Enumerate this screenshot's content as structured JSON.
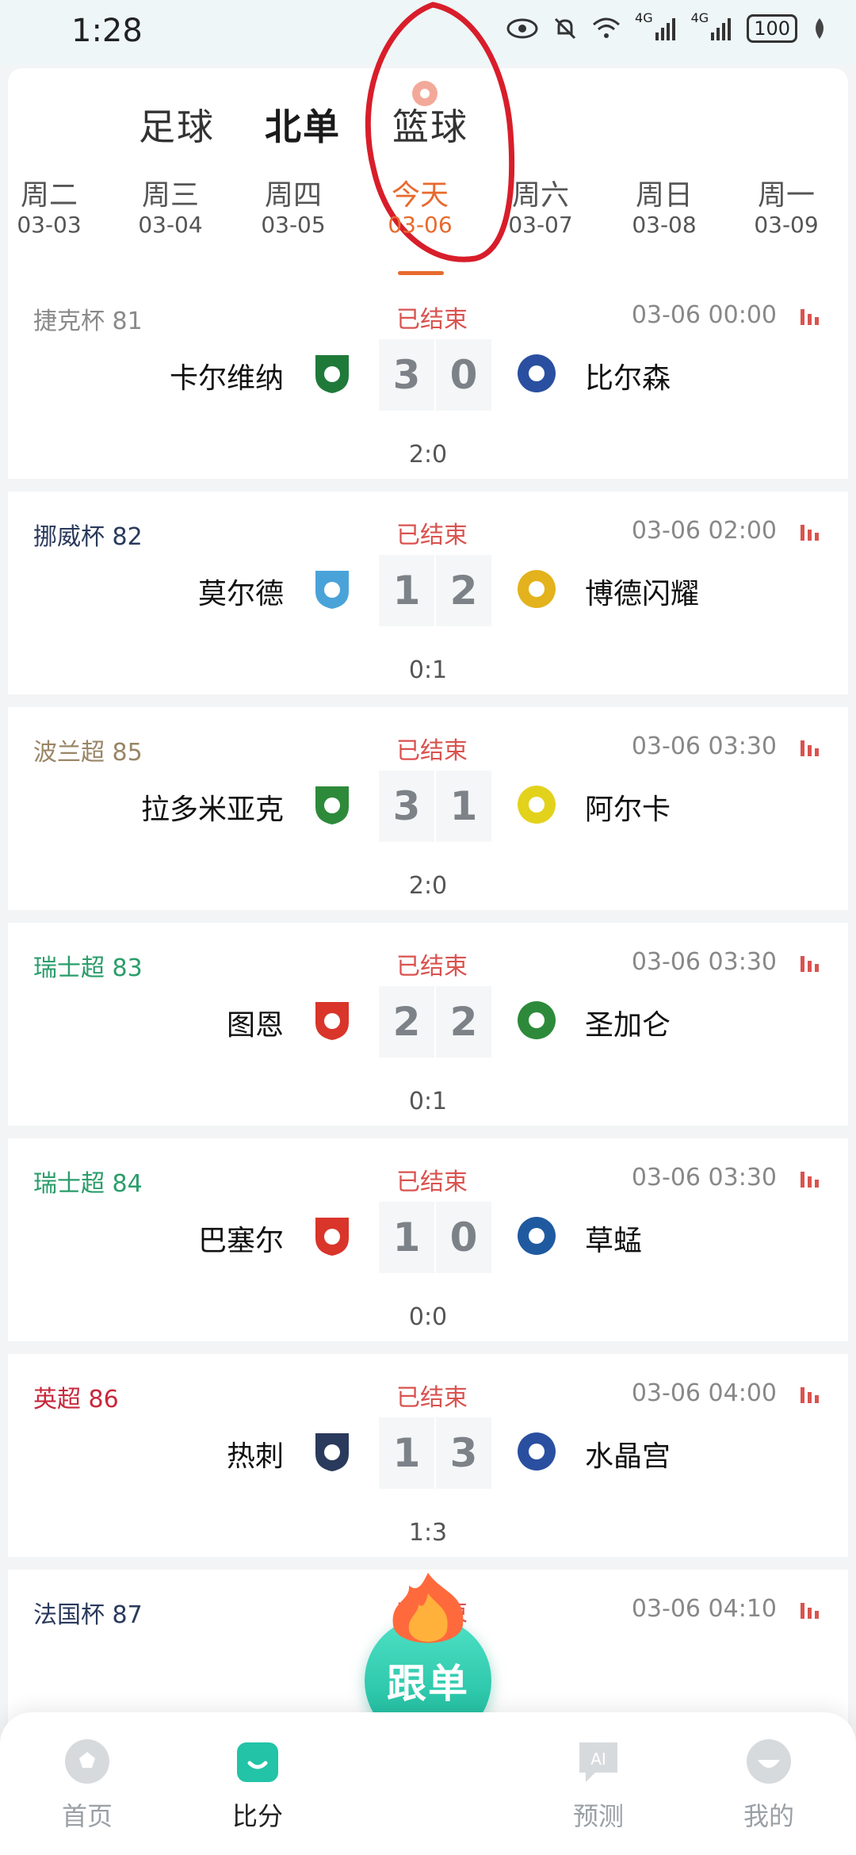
{
  "status_bar": {
    "time": "1:28",
    "battery": "100",
    "network_labels": [
      "4G",
      "4G"
    ]
  },
  "top_tabs": [
    {
      "label": "足球",
      "active": false
    },
    {
      "label": "北单",
      "active": true
    },
    {
      "label": "篮球",
      "active": false
    }
  ],
  "dates": [
    {
      "weekday": "周二",
      "date": "03-03",
      "active": false
    },
    {
      "weekday": "周三",
      "date": "03-04",
      "active": false
    },
    {
      "weekday": "周四",
      "date": "03-05",
      "active": false
    },
    {
      "weekday": "今天",
      "date": "03-06",
      "active": true
    },
    {
      "weekday": "周六",
      "date": "03-07",
      "active": false
    },
    {
      "weekday": "周日",
      "date": "03-08",
      "active": false
    },
    {
      "weekday": "周一",
      "date": "03-09",
      "active": false
    }
  ],
  "matches": [
    {
      "league": "捷克杯 81",
      "league_color": "#8a8a8a",
      "status": "已结束",
      "time": "03-06 00:00",
      "home": "卡尔维纳",
      "away": "比尔森",
      "home_score": "3",
      "away_score": "0",
      "half_time": "2:0"
    },
    {
      "league": "挪威杯 82",
      "league_color": "#2a3a5c",
      "status": "已结束",
      "time": "03-06 02:00",
      "home": "莫尔德",
      "away": "博德闪耀",
      "home_score": "1",
      "away_score": "2",
      "half_time": "0:1"
    },
    {
      "league": "波兰超 85",
      "league_color": "#9a8566",
      "status": "已结束",
      "time": "03-06 03:30",
      "home": "拉多米亚克",
      "away": "阿尔卡",
      "home_score": "3",
      "away_score": "1",
      "half_time": "2:0"
    },
    {
      "league": "瑞士超 83",
      "league_color": "#2a9d6a",
      "status": "已结束",
      "time": "03-06 03:30",
      "home": "图恩",
      "away": "圣加仑",
      "home_score": "2",
      "away_score": "2",
      "half_time": "0:1"
    },
    {
      "league": "瑞士超 84",
      "league_color": "#2a9d6a",
      "status": "已结束",
      "time": "03-06 03:30",
      "home": "巴塞尔",
      "away": "草蜢",
      "home_score": "1",
      "away_score": "0",
      "half_time": "0:0"
    },
    {
      "league": "英超 86",
      "league_color": "#c8283c",
      "status": "已结束",
      "time": "03-06 04:00",
      "home": "热刺",
      "away": "水晶宫",
      "home_score": "1",
      "away_score": "3",
      "half_time": "1:3"
    },
    {
      "league": "法国杯 87",
      "league_color": "#2a3a5c",
      "status": "已结束",
      "time": "03-06 04:10",
      "home": "",
      "away": "",
      "home_score": "",
      "away_score": "",
      "half_time": ""
    }
  ],
  "fab": {
    "label": "跟单"
  },
  "bottom_nav": [
    {
      "label": "首页",
      "icon": "soccer-ball-icon",
      "active": false
    },
    {
      "label": "比分",
      "icon": "score-icon",
      "active": true
    },
    {
      "label": "预测",
      "icon": "ai-chat-icon",
      "active": false
    },
    {
      "label": "我的",
      "icon": "profile-icon",
      "active": false
    }
  ],
  "colors": {
    "accent": "#e86a2e",
    "status_red": "#d9534f",
    "fab_green": "#18b79a",
    "annotation_red": "#d81e2a"
  }
}
